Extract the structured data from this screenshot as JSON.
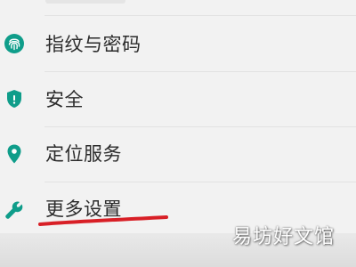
{
  "settings": {
    "items": [
      {
        "label": "指纹与密码",
        "icon": "fingerprint-icon"
      },
      {
        "label": "安全",
        "icon": "shield-icon"
      },
      {
        "label": "定位服务",
        "icon": "location-pin-icon"
      },
      {
        "label": "更多设置",
        "icon": "wrench-icon"
      }
    ]
  },
  "watermark": {
    "text": "易坊好文馆"
  },
  "colors": {
    "icon_teal": "#0f9d8a",
    "annotation_red": "#d81f26",
    "background": "#f2f2f2"
  }
}
